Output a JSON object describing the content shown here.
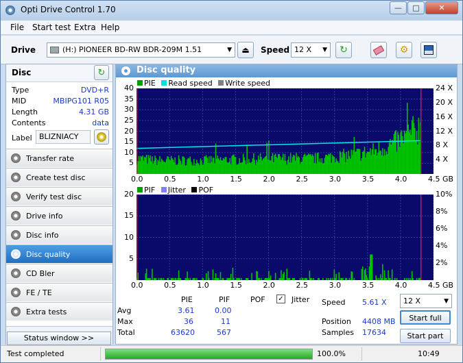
{
  "window": {
    "title": "Opti Drive Control 1.70"
  },
  "menu": [
    "File",
    "Start test",
    "Extra",
    "Help"
  ],
  "toolbar": {
    "drive_label": "Drive",
    "drive_value": "(H:)  PIONEER BD-RW   BDR-209M 1.51",
    "speed_label": "Speed",
    "speed_value": "12 X"
  },
  "disc": {
    "title": "Disc",
    "type_label": "Type",
    "type": "DVD+R",
    "mid_label": "MID",
    "mid": "MBIPG101 R05",
    "length_label": "Length",
    "length": "4.31 GB",
    "contents_label": "Contents",
    "contents": "data",
    "label_label": "Label",
    "label": "BLIZNIACY"
  },
  "nav": [
    "Transfer rate",
    "Create test disc",
    "Verify test disc",
    "Drive info",
    "Disc info",
    "Disc quality",
    "CD Bler",
    "FE / TE",
    "Extra tests"
  ],
  "nav_active_index": 5,
  "status_window": "Status window >>",
  "panel": {
    "title": "Disc quality"
  },
  "chart_data": [
    {
      "type": "bar",
      "legend": [
        {
          "name": "PIE",
          "color": "#00c000"
        },
        {
          "name": "Read speed",
          "color": "#00e0e0"
        },
        {
          "name": "Write speed",
          "color": "#808080"
        }
      ],
      "ylim": [
        0,
        40
      ],
      "yticks": [
        5,
        10,
        15,
        20,
        25,
        30,
        35,
        40
      ],
      "y2ticks": [
        "4 X",
        "8 X",
        "12 X",
        "16 X",
        "20 X",
        "24 X"
      ],
      "xticks": [
        "0.0",
        "0.5",
        "1.0",
        "1.5",
        "2.0",
        "2.5",
        "3.0",
        "3.5",
        "4.0",
        "4.5 GB"
      ],
      "xlim": [
        0,
        4.5
      ],
      "end_marker": 4.31,
      "pie_profile": [
        [
          0,
          8
        ],
        [
          0.3,
          7
        ],
        [
          1.0,
          7
        ],
        [
          2.0,
          8
        ],
        [
          2.7,
          8
        ],
        [
          3.0,
          9
        ],
        [
          3.3,
          10
        ],
        [
          3.6,
          12
        ],
        [
          3.9,
          16
        ],
        [
          4.1,
          20
        ],
        [
          4.31,
          25
        ]
      ],
      "read_speed_profile": [
        [
          0,
          4.3
        ],
        [
          4.31,
          5.6
        ]
      ]
    },
    {
      "type": "bar",
      "legend": [
        {
          "name": "PIF",
          "color": "#00c000"
        },
        {
          "name": "Jitter",
          "color": "#8080ff"
        },
        {
          "name": "POF",
          "color": "#000000"
        }
      ],
      "ylim": [
        0,
        20
      ],
      "yticks": [
        5,
        10,
        15,
        20
      ],
      "y2ticks": [
        "2%",
        "4%",
        "6%",
        "8%",
        "10%"
      ],
      "xticks": [
        "0.0",
        "0.5",
        "1.0",
        "1.5",
        "2.0",
        "2.5",
        "3.0",
        "3.5",
        "4.0",
        "4.5 GB"
      ],
      "xlim": [
        0,
        4.5
      ],
      "end_marker": 4.31
    }
  ],
  "stats": {
    "headers": [
      "PIE",
      "PIF",
      "POF",
      "Jitter"
    ],
    "rows": [
      {
        "label": "Avg",
        "pie": "3.61",
        "pif": "0.00"
      },
      {
        "label": "Max",
        "pie": "36",
        "pif": "11"
      },
      {
        "label": "Total",
        "pie": "63620",
        "pif": "567"
      }
    ],
    "speed_label": "Speed",
    "speed": "5.61 X",
    "position_label": "Position",
    "position": "4408 MB",
    "samples_label": "Samples",
    "samples": "17634",
    "speed_select": "12 X",
    "start_full": "Start full",
    "start_part": "Start part"
  },
  "status": {
    "text": "Test completed",
    "progress": 100.0,
    "progress_text": "100.0%",
    "time": "10:49"
  }
}
